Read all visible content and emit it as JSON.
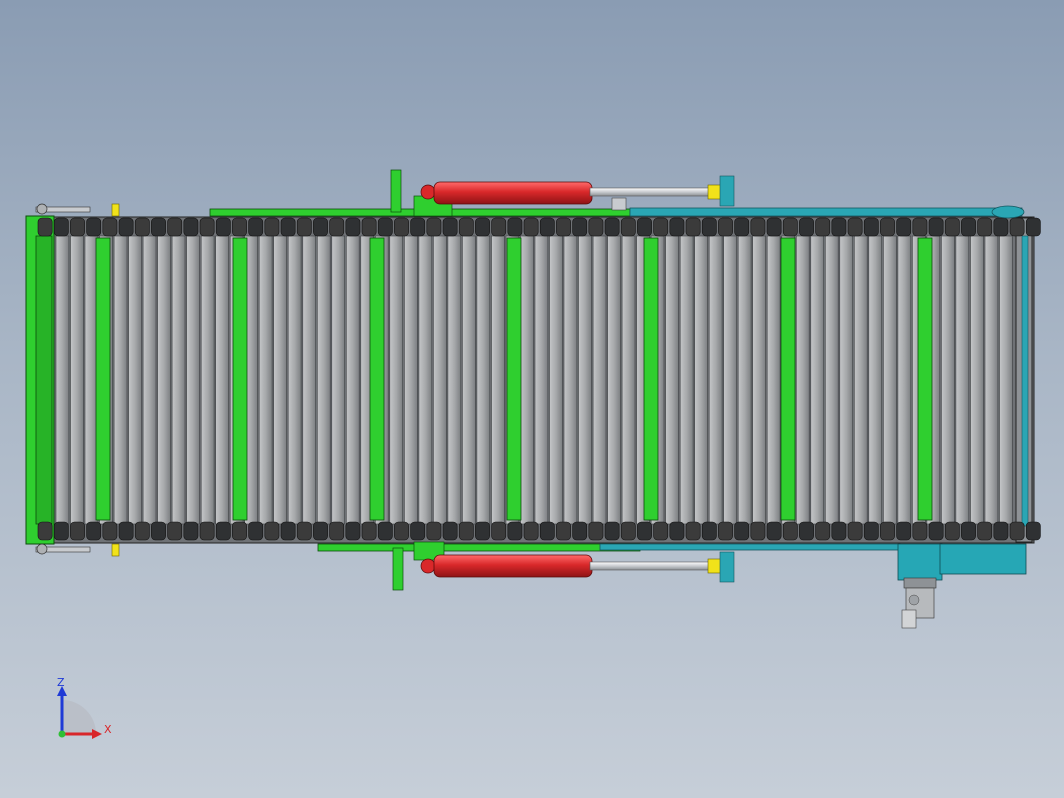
{
  "viewport": {
    "background_top": "#8a9cb3",
    "background_bottom": "#c6ced8"
  },
  "model": {
    "component": "chain-slat-conveyor",
    "colors": {
      "frame_green": "#2fcf2f",
      "frame_teal": "#2aa6b4",
      "chain": "#3b3b3b",
      "slat": "#a7a9ab",
      "cylinder": "#d9282a",
      "rod": "#c8cbcf",
      "clevis": "#f1e21a",
      "motor": "#26a7b5",
      "gearbox": "#b7babd"
    },
    "cross_member_count": 7,
    "slat_count": 66,
    "hydraulic_cylinders": 2
  },
  "triad": {
    "z_label": "Z",
    "x_label": "X",
    "z_color": "#1f3ad6",
    "x_color": "#d8262a",
    "y_color": "#2fbf36"
  }
}
